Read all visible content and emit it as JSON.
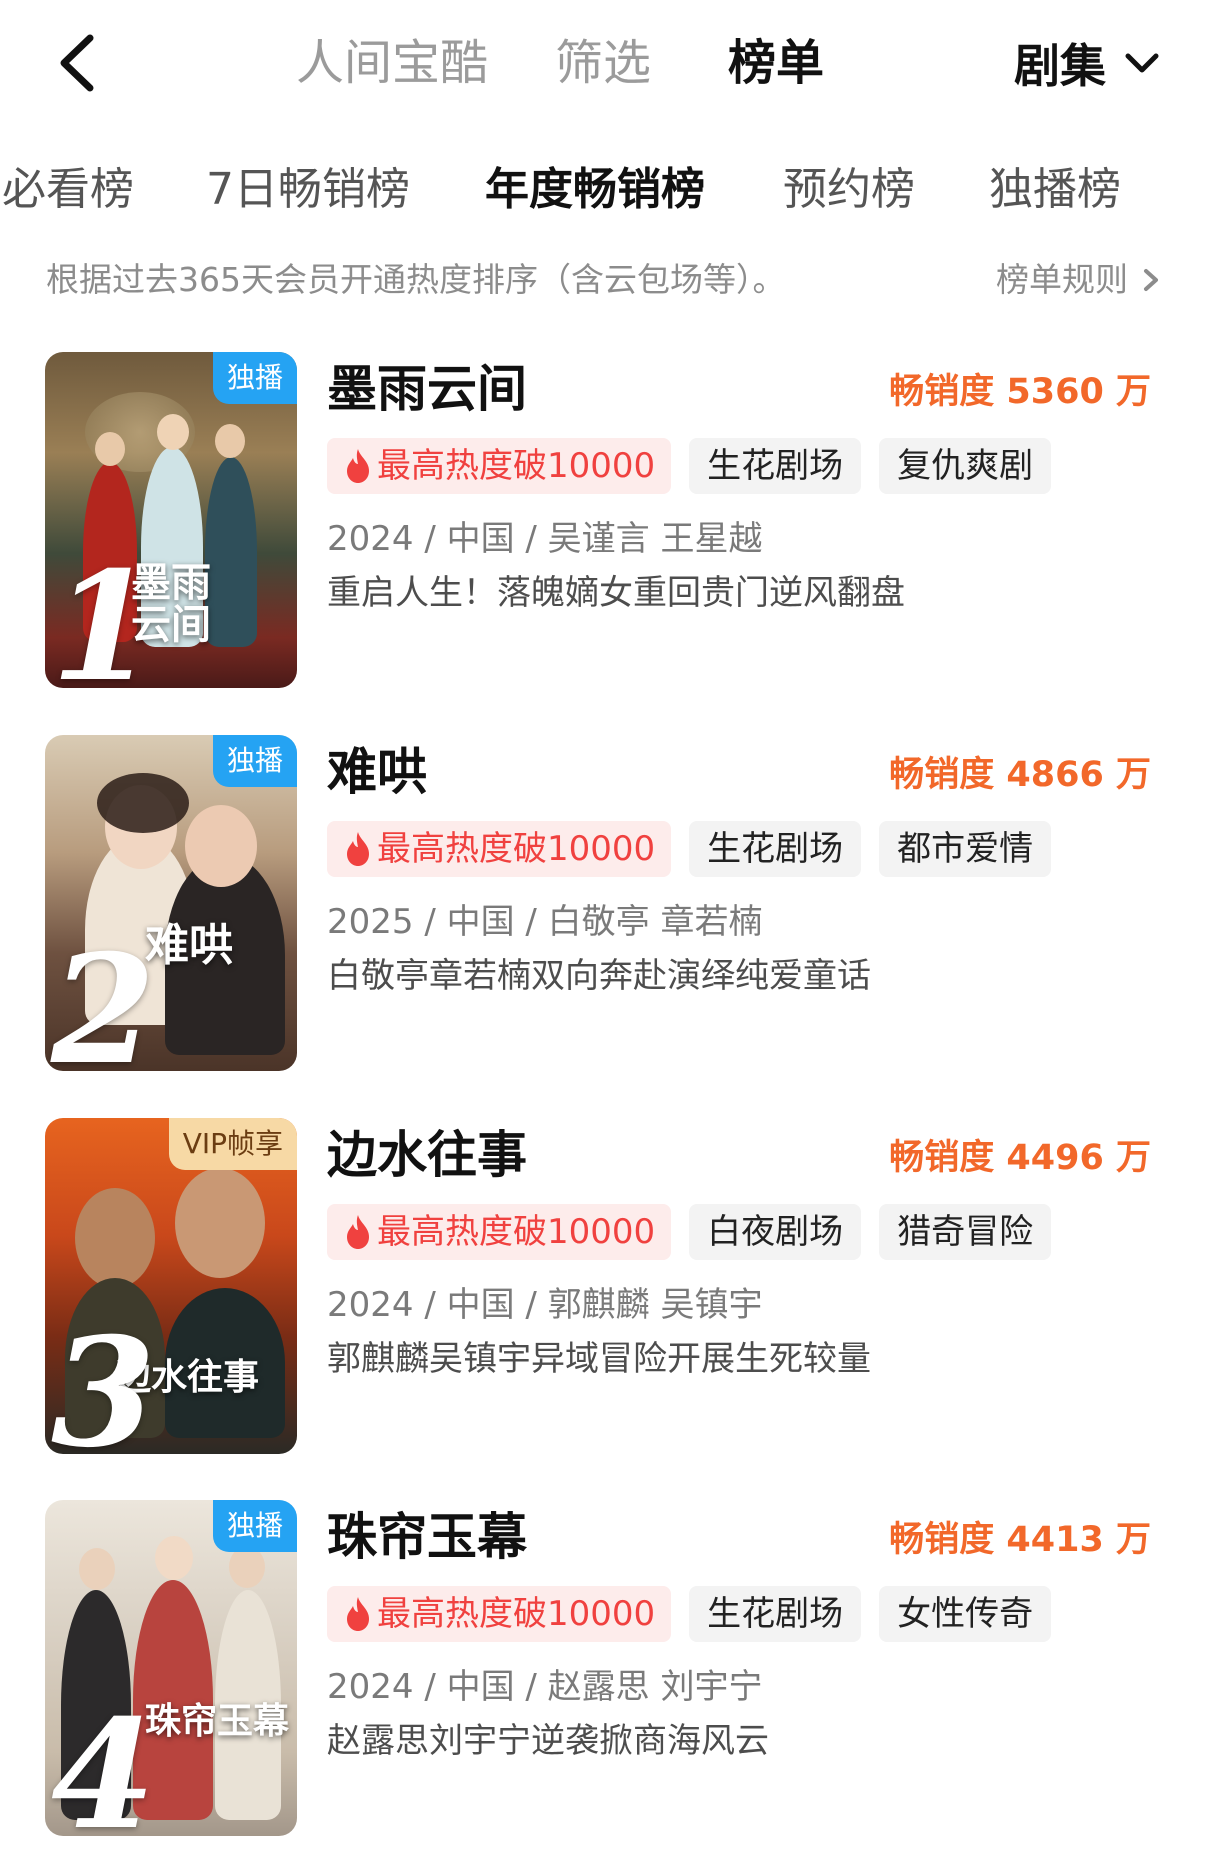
{
  "nav": {
    "tabs": [
      {
        "label": "人间宝酷",
        "active": false
      },
      {
        "label": "筛选",
        "active": false
      },
      {
        "label": "榜单",
        "active": true
      }
    ],
    "category": "剧集"
  },
  "rank_tabs": [
    {
      "label": "必看榜",
      "active": false
    },
    {
      "label": "7日畅销榜",
      "active": false
    },
    {
      "label": "年度畅销榜",
      "active": true
    },
    {
      "label": "预约榜",
      "active": false
    },
    {
      "label": "独播榜",
      "active": false
    }
  ],
  "description": "根据过去365天会员开通热度排序（含云包场等）。",
  "rules_label": "榜单规则",
  "colors": {
    "accent_orange": "#f2682a",
    "hot_red": "#f0413f",
    "exclusive_blue": "#25a3f3",
    "vip_gold": "#f7d9a5"
  },
  "items": [
    {
      "rank": "1",
      "badge": "独播",
      "badge_type": "exclusive",
      "poster_text": "墨雨\n云间",
      "title": "墨雨云间",
      "sales": "畅销度 5360 万",
      "hot_tag": "最高热度破10000",
      "tags": [
        "生花剧场",
        "复仇爽剧"
      ],
      "meta": "2024 / 中国 / 吴谨言 王星越",
      "summary": "重启人生！落魄嫡女重回贵门逆风翻盘"
    },
    {
      "rank": "2",
      "badge": "独播",
      "badge_type": "exclusive",
      "poster_text": "难哄",
      "title": "难哄",
      "sales": "畅销度 4866 万",
      "hot_tag": "最高热度破10000",
      "tags": [
        "生花剧场",
        "都市爱情"
      ],
      "meta": "2025 / 中国 / 白敬亭 章若楠",
      "summary": "白敬亭章若楠双向奔赴演绎纯爱童话"
    },
    {
      "rank": "3",
      "badge": "VIP帧享",
      "badge_type": "vip",
      "poster_text": "边水往事",
      "title": "边水往事",
      "sales": "畅销度 4496 万",
      "hot_tag": "最高热度破10000",
      "tags": [
        "白夜剧场",
        "猎奇冒险"
      ],
      "meta": "2024 / 中国 / 郭麒麟 吴镇宇",
      "summary": "郭麒麟吴镇宇异域冒险开展生死较量"
    },
    {
      "rank": "4",
      "badge": "独播",
      "badge_type": "exclusive",
      "poster_text": "珠帘玉幕",
      "title": "珠帘玉幕",
      "sales": "畅销度 4413 万",
      "hot_tag": "最高热度破10000",
      "tags": [
        "生花剧场",
        "女性传奇"
      ],
      "meta": "2024 / 中国 / 赵露思 刘宇宁",
      "summary": "赵露思刘宇宁逆袭掀商海风云"
    }
  ]
}
